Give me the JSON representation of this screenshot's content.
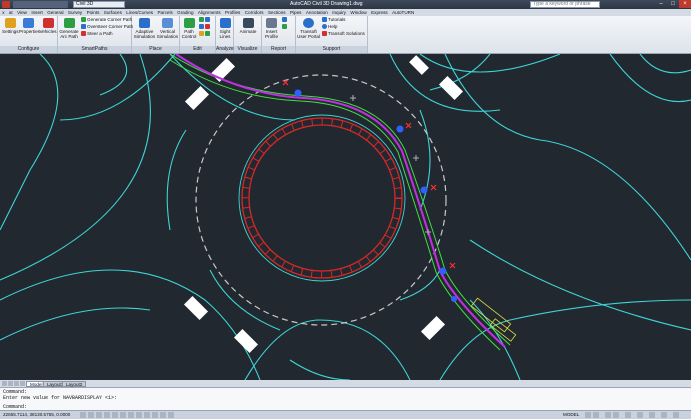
{
  "title_bar": {
    "workspace": "Civil 3D",
    "window_title": "AutoCAD Civil 3D  Drawing1.dwg",
    "search_placeholder": "Type a keyword or phrase"
  },
  "menu_bar": [
    "x",
    "at",
    "View",
    "Insert",
    "General",
    "Survey",
    "Points",
    "Surfaces",
    "Lines/Curves",
    "Parcels",
    "Grading",
    "Alignments",
    "Profiles",
    "Corridors",
    "Sections",
    "Pipes",
    "Annotation",
    "Inquiry",
    "Window",
    "Express",
    "AutoTURN"
  ],
  "ribbon": {
    "panels": {
      "configure": "Configure",
      "smartpaths": "SmartPaths",
      "place": "Place",
      "edit": "Edit",
      "analyze": "Analyze",
      "visualize": "Visualize",
      "report": "Report",
      "support": "Support"
    },
    "tools": {
      "settings": "Settings",
      "properties": "Properties",
      "vehicles": "Vehicles",
      "generate_arc_path_1": "Generate",
      "generate_arc_path_2": "Arc Path",
      "generate_corner_path": "Generate Corner Path",
      "oversteer_corner_path": "Oversteer Corner Path",
      "steer_a_path": "Steer a Path",
      "adaptive_sim_1": "Adaptive",
      "adaptive_sim_2": "Simulation",
      "vertical_sim_1": "Vertical",
      "vertical_sim_2": "Simulation",
      "path_control_1": "Path",
      "path_control_2": "Control",
      "sight_lines_1": "Sight",
      "sight_lines_2": "Lines",
      "animate": "Animate",
      "insert_profile_1": "Insert",
      "insert_profile_2": "Profile",
      "transoft_portal_1": "Transoft",
      "transoft_portal_2": "User Portal",
      "tutorials": "Tutorials",
      "help": "Help",
      "transoft_solutions": "Transoft Solutions"
    },
    "icon_colors": {
      "settings": "#e0a020",
      "properties": "#3a7bd5",
      "vehicles": "#d03030",
      "accent_green": "#2e9e44",
      "accent_blue": "#2a6fc9"
    }
  },
  "drawing": {
    "colors": {
      "background": "#212830",
      "road_edge": "#3ed4d4",
      "center_island": "#d42828",
      "vehicle_path": "#c030e0",
      "wheel_path": "#40e040",
      "dashed_circle": "#c8c8c8",
      "markers": "#3060ff",
      "x_marks": "#ff3030"
    }
  },
  "layout_tabs": [
    "Model",
    "Layout1",
    "Layout2"
  ],
  "command_line": {
    "line1": "Command:",
    "line2": "Enter new value for NAVBARDISPLAY <1>:",
    "line3": "Command:"
  },
  "status_bar": {
    "coordinates": "22655.7114, 38130.5755, 0.0000",
    "model_label": "MODEL"
  }
}
